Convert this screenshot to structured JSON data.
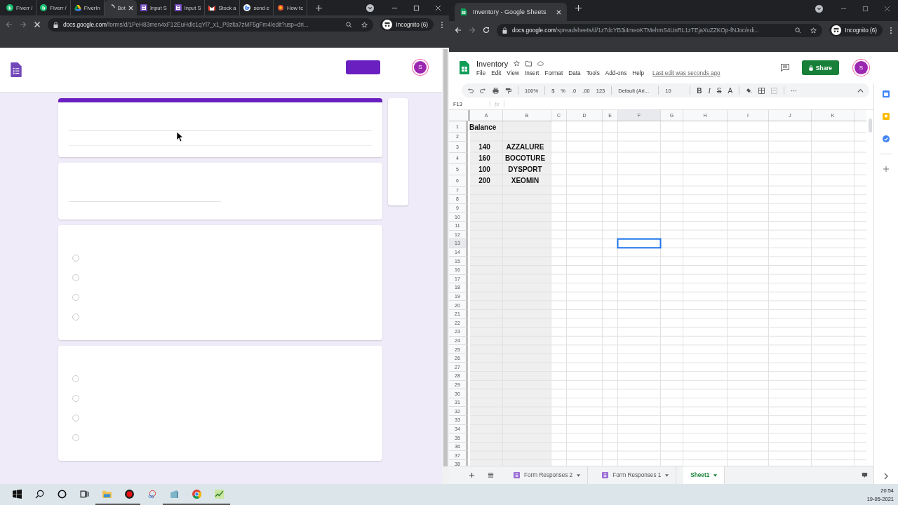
{
  "left_window": {
    "tabs": [
      {
        "label": "Fiverr /",
        "kind": "fiverr",
        "selected": false
      },
      {
        "label": "Fiverr /",
        "kind": "fiverr",
        "selected": false
      },
      {
        "label": "FiverIn",
        "kind": "drive",
        "selected": false
      },
      {
        "label": "Bot",
        "kind": "loading",
        "selected": true
      },
      {
        "label": "Input S",
        "kind": "forms",
        "selected": false
      },
      {
        "label": "Input S",
        "kind": "forms",
        "selected": false
      },
      {
        "label": "Stock a",
        "kind": "gmail",
        "selected": false
      },
      {
        "label": "send e",
        "kind": "google",
        "selected": false
      },
      {
        "label": "How tc",
        "kind": "site",
        "selected": false
      }
    ],
    "address": {
      "host": "docs.google.com",
      "path": "/forms/d/1PeH83men4xF12EuHdlc1qYl7_x1_P9zlta7zMF5gFm4/edit?usp=dri..."
    },
    "profile": "Incognito (6)",
    "form": {
      "avatar": "S",
      "cards": [
        {
          "kind": "header"
        },
        {
          "kind": "text"
        },
        {
          "kind": "choice",
          "options": [
            {
              "selected": false
            },
            {
              "selected": false
            },
            {
              "selected": false
            },
            {
              "selected": false
            }
          ]
        },
        {
          "kind": "choice",
          "options": [
            {
              "selected": false
            },
            {
              "selected": false
            },
            {
              "selected": false
            },
            {
              "selected": false
            }
          ]
        }
      ]
    }
  },
  "right_window": {
    "tab": {
      "label": "Inventory - Google Sheets",
      "selected": true
    },
    "address": {
      "host": "docs.google.com",
      "path": "/spreadsheets/d/1z7dcYB3i4meoKTMehmS4UnRL1zTEjaXuZZKOp-fNJoc/edi..."
    },
    "profile": "Incognito (6)",
    "sheet": {
      "title": "Inventory",
      "menu": [
        "File",
        "Edit",
        "View",
        "Insert",
        "Format",
        "Data",
        "Tools",
        "Add-ons",
        "Help"
      ],
      "last_edit": "Last edit was seconds ago",
      "share": "Share",
      "avatar": "S",
      "toolbar": {
        "zoom": "100%",
        "currency": "$",
        "percent": "%",
        "decrease_decimals": ".0",
        "increase_decimals": ".00",
        "number_format": "123",
        "font": "Default (Ari...",
        "font_size": "10",
        "bold": "B",
        "italic": "I",
        "strikethrough": "S",
        "text_color": "A"
      },
      "name_box": "F13",
      "formula_label": "fx",
      "columns": [
        {
          "label": "A",
          "shaded": true,
          "selected": false
        },
        {
          "label": "B",
          "shaded": true,
          "selected": false
        },
        {
          "label": "C",
          "shaded": false,
          "selected": false
        },
        {
          "label": "D",
          "shaded": false,
          "selected": false
        },
        {
          "label": "E",
          "shaded": false,
          "selected": false
        },
        {
          "label": "F",
          "shaded": false,
          "selected": true
        },
        {
          "label": "G",
          "shaded": false,
          "selected": false
        },
        {
          "label": "H",
          "shaded": false,
          "selected": false
        },
        {
          "label": "I",
          "shaded": false,
          "selected": false
        },
        {
          "label": "J",
          "shaded": false,
          "selected": false
        },
        {
          "label": "K",
          "shaded": false,
          "selected": false
        }
      ],
      "rows": [
        {
          "number": "1",
          "selected": false,
          "kind": "heading",
          "cells": [
            "Balance"
          ]
        },
        {
          "number": "2",
          "selected": false
        },
        {
          "number": "3",
          "selected": false,
          "kind": "data",
          "cells": [
            "140",
            "AZZALURE"
          ]
        },
        {
          "number": "4",
          "selected": false,
          "kind": "data",
          "cells": [
            "160",
            "BOCOTURE"
          ]
        },
        {
          "number": "5",
          "selected": false,
          "kind": "data",
          "cells": [
            "100",
            "DYSPORT"
          ]
        },
        {
          "number": "6",
          "selected": false,
          "kind": "data",
          "cells": [
            "200",
            "XEOMIN"
          ]
        },
        {
          "number": "7",
          "selected": false
        },
        {
          "number": "8",
          "selected": false
        },
        {
          "number": "9",
          "selected": false
        },
        {
          "number": "10",
          "selected": false
        },
        {
          "number": "11",
          "selected": false
        },
        {
          "number": "12",
          "selected": false
        },
        {
          "number": "13",
          "selected": true
        },
        {
          "number": "14",
          "selected": false
        },
        {
          "number": "15",
          "selected": false
        },
        {
          "number": "16",
          "selected": false
        },
        {
          "number": "17",
          "selected": false
        },
        {
          "number": "18",
          "selected": false
        },
        {
          "number": "19",
          "selected": false
        },
        {
          "number": "20",
          "selected": false
        },
        {
          "number": "21",
          "selected": false
        },
        {
          "number": "22",
          "selected": false
        },
        {
          "number": "23",
          "selected": false
        },
        {
          "number": "24",
          "selected": false
        },
        {
          "number": "25",
          "selected": false
        },
        {
          "number": "26",
          "selected": false
        },
        {
          "number": "27",
          "selected": false
        },
        {
          "number": "28",
          "selected": false
        },
        {
          "number": "29",
          "selected": false
        },
        {
          "number": "30",
          "selected": false
        },
        {
          "number": "31",
          "selected": false
        },
        {
          "number": "32",
          "selected": false
        },
        {
          "number": "33",
          "selected": false
        },
        {
          "number": "34",
          "selected": false
        },
        {
          "number": "35",
          "selected": false
        },
        {
          "number": "36",
          "selected": false
        },
        {
          "number": "37",
          "selected": false
        },
        {
          "number": "38",
          "selected": false
        }
      ],
      "sheet_tabs": [
        {
          "label": "Form Responses 2",
          "linked_form": true,
          "selected": false
        },
        {
          "label": "Form Responses 1",
          "linked_form": true,
          "selected": false
        },
        {
          "label": "Sheet1",
          "linked_form": false,
          "selected": true
        }
      ]
    }
  },
  "taskbar": {
    "icons": [
      {
        "kind": "windows",
        "running": false
      },
      {
        "kind": "search",
        "running": false
      },
      {
        "kind": "cortana",
        "running": false
      },
      {
        "kind": "taskview",
        "running": false
      },
      {
        "kind": "folder",
        "running": true
      },
      {
        "kind": "record",
        "running": true
      },
      {
        "kind": "snip",
        "running": false
      },
      {
        "kind": "notes",
        "running": true
      },
      {
        "kind": "chrome",
        "running": true
      },
      {
        "kind": "chart",
        "running": true
      }
    ],
    "time": "20:54",
    "date": "19-05-2021"
  }
}
